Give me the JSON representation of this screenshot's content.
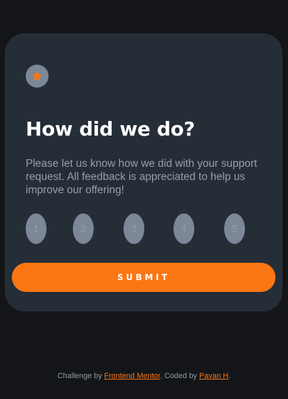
{
  "card": {
    "icon": "star-icon",
    "title": "How did we do?",
    "description": "Please let us know how we did with your support request. All feedback is appreciated to help us improve our offering!",
    "ratings": [
      "1",
      "2",
      "3",
      "4",
      "5"
    ],
    "submit_label": "SUBMIT"
  },
  "attribution": {
    "prefix": "Challenge by ",
    "frontend_mentor_link": "Frontend Mentor",
    "middle": ". Coded by ",
    "author_link": "Pavan H",
    "suffix": "."
  },
  "colors": {
    "background": "#131518",
    "card": "#252d37",
    "accent": "#fc7614",
    "button_gray": "#7c8798",
    "text_muted": "#969fad",
    "white": "#ffffff"
  }
}
